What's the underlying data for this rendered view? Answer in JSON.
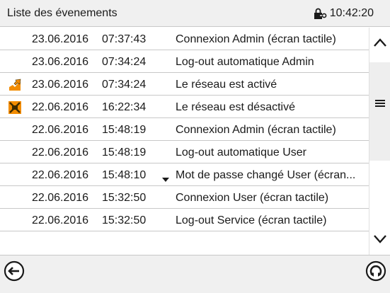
{
  "header": {
    "title": "Liste des évenements",
    "clock": "10:42:20",
    "lock_icon": "lock-key-icon"
  },
  "events": [
    {
      "date": "23.06.2016",
      "time": "07:37:43",
      "desc": "Connexion Admin (écran tactile)",
      "icon": null,
      "details": false
    },
    {
      "date": "23.06.2016",
      "time": "07:34:24",
      "desc": "Log-out automatique Admin",
      "icon": null,
      "details": false
    },
    {
      "date": "23.06.2016",
      "time": "07:34:24",
      "desc": "Le réseau est activé",
      "icon": "network-on-icon",
      "details": false
    },
    {
      "date": "22.06.2016",
      "time": "16:22:34",
      "desc": "Le réseau est désactivé",
      "icon": "network-off-icon",
      "details": false
    },
    {
      "date": "22.06.2016",
      "time": "15:48:19",
      "desc": "Connexion Admin (écran tactile)",
      "icon": null,
      "details": false
    },
    {
      "date": "22.06.2016",
      "time": "15:48:19",
      "desc": "Log-out automatique User",
      "icon": null,
      "details": false
    },
    {
      "date": "22.06.2016",
      "time": "15:48:10",
      "desc": "Mot de passe changé User (écran...",
      "icon": null,
      "details": true
    },
    {
      "date": "22.06.2016",
      "time": "15:32:50",
      "desc": "Connexion User (écran tactile)",
      "icon": null,
      "details": false
    },
    {
      "date": "22.06.2016",
      "time": "15:32:50",
      "desc": "Log-out Service (écran tactile)",
      "icon": null,
      "details": false
    },
    {
      "date": "",
      "time": "",
      "desc": "",
      "icon": null,
      "details": false
    }
  ],
  "scrollbar": {
    "up_icon": "chevron-up-icon",
    "thumb_icon": "menu-lines-icon",
    "down_icon": "chevron-down-icon"
  },
  "footer": {
    "back_icon": "back-arrow-icon",
    "refresh_icon": "refresh-icon"
  },
  "colors": {
    "network_icon_orange": "#f28c00",
    "network_icon_dark": "#3c2a00",
    "text": "#1a1a1a",
    "bar_background": "#f0f0f0"
  }
}
